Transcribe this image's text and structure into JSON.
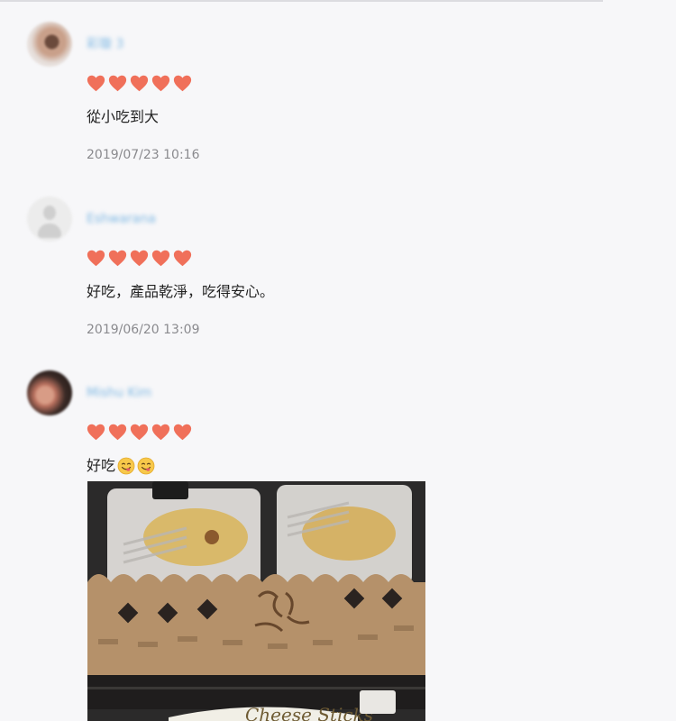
{
  "reviews": [
    {
      "username": "彩璇 3",
      "rating": 5,
      "comment": "從小吃到大",
      "timestamp": "2019/07/23 10:16"
    },
    {
      "username": "Eshwarana",
      "rating": 5,
      "comment": "好吃，產品乾淨，吃得安心。",
      "timestamp": "2019/06/20 13:09"
    },
    {
      "username": "Mishu Kim",
      "rating": 5,
      "comment": "好吃",
      "comment_emojis": [
        "yum-face-emoji",
        "yum-face-emoji"
      ],
      "photo_text": "Cheese Sticks"
    }
  ],
  "colors": {
    "heart": "#f0705a",
    "username": "#7fb8e3",
    "timestamp": "#8a8a8e",
    "background": "#f7f7f9"
  }
}
